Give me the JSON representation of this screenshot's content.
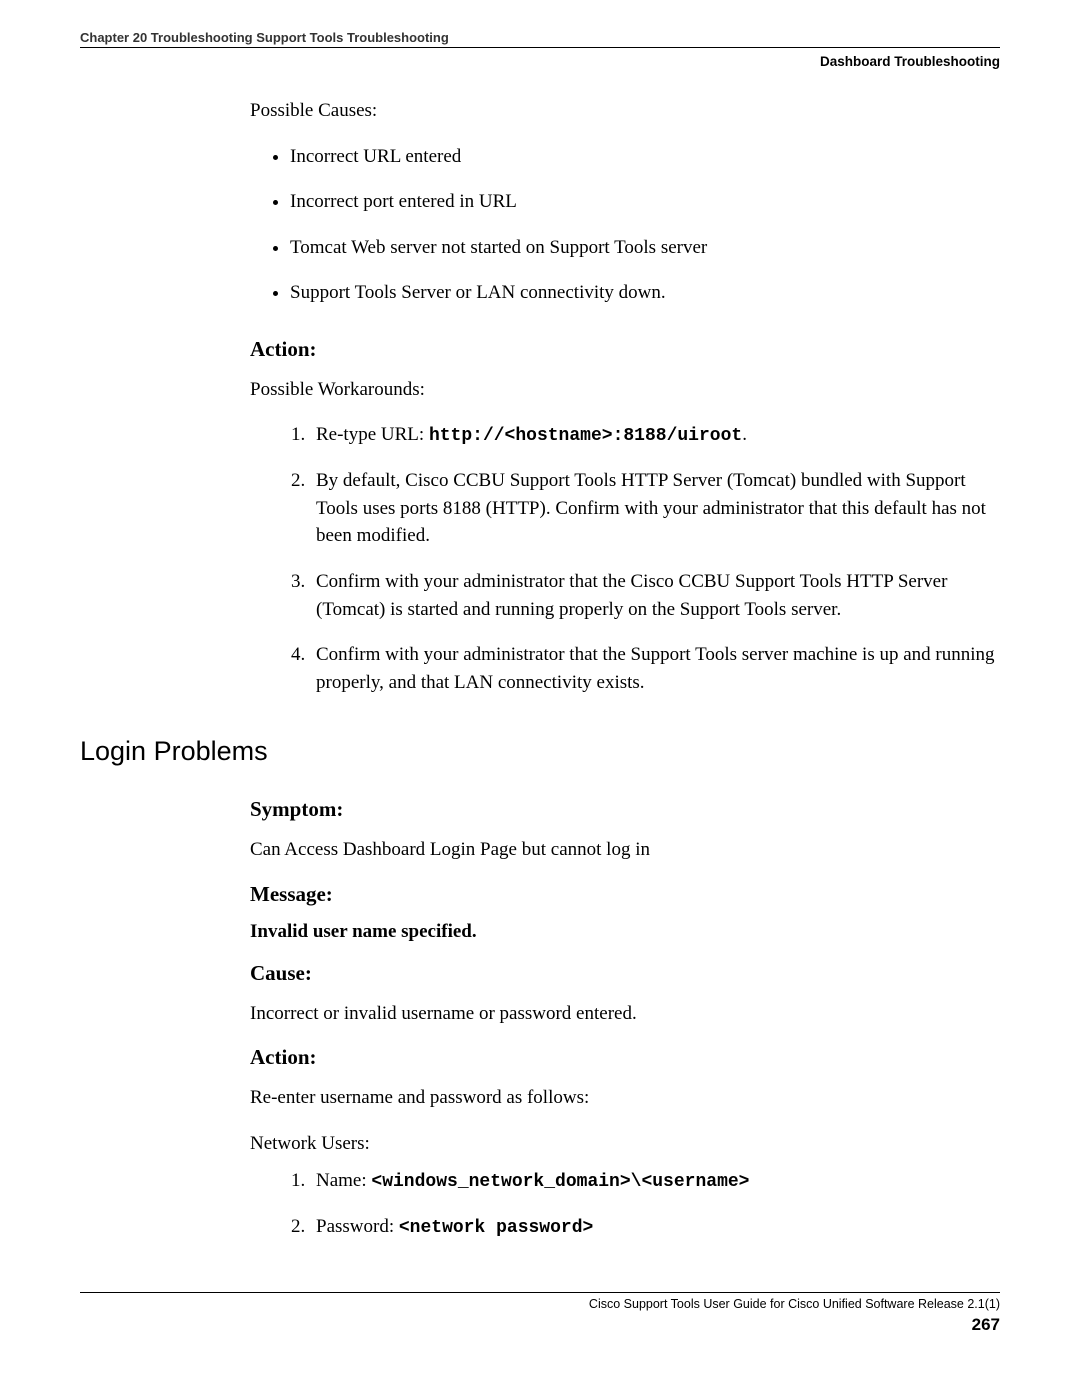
{
  "header": {
    "left": "Chapter 20 Troubleshooting Support Tools Troubleshooting",
    "right": "Dashboard Troubleshooting"
  },
  "intro": {
    "possible_causes_label": "Possible Causes:",
    "causes": [
      "Incorrect URL entered",
      "Incorrect port entered in URL",
      "Tomcat Web server not started on Support Tools server",
      "Support Tools Server or LAN connectivity down."
    ]
  },
  "action1": {
    "heading": "Action:",
    "possible_workarounds_label": "Possible Workarounds:",
    "item1_prefix": "Re-type URL: ",
    "item1_code": "http://<hostname>:8188/uiroot",
    "item1_suffix": ".",
    "item2": "By default, Cisco CCBU Support Tools HTTP Server (Tomcat) bundled with Support Tools uses ports 8188 (HTTP). Confirm with your administrator that this default has not been modified.",
    "item3": "Confirm with your administrator that the Cisco CCBU Support Tools HTTP Server (Tomcat) is started and running properly on the Support Tools server.",
    "item4": "Confirm with your administrator that the Support Tools server machine is up and running properly, and that LAN connectivity exists."
  },
  "login": {
    "section_title": "Login Problems",
    "symptom_heading": "Symptom:",
    "symptom_text": "Can Access Dashboard Login Page but cannot log in",
    "message_heading": "Message:",
    "message_text": "Invalid user name specified.",
    "cause_heading": "Cause:",
    "cause_text": "Incorrect or invalid username or password entered.",
    "action_heading": "Action:",
    "action_text": "Re-enter username and password as follows:",
    "network_users_label": "Network Users:",
    "net_item1_prefix": "Name: ",
    "net_item1_code": "<windows_network_domain>\\<username>",
    "net_item2_prefix": "Password: ",
    "net_item2_code": "<network password>"
  },
  "footer": {
    "doc_title": "Cisco Support Tools User Guide for Cisco Unified Software Release 2.1(1)",
    "page_number": "267"
  }
}
